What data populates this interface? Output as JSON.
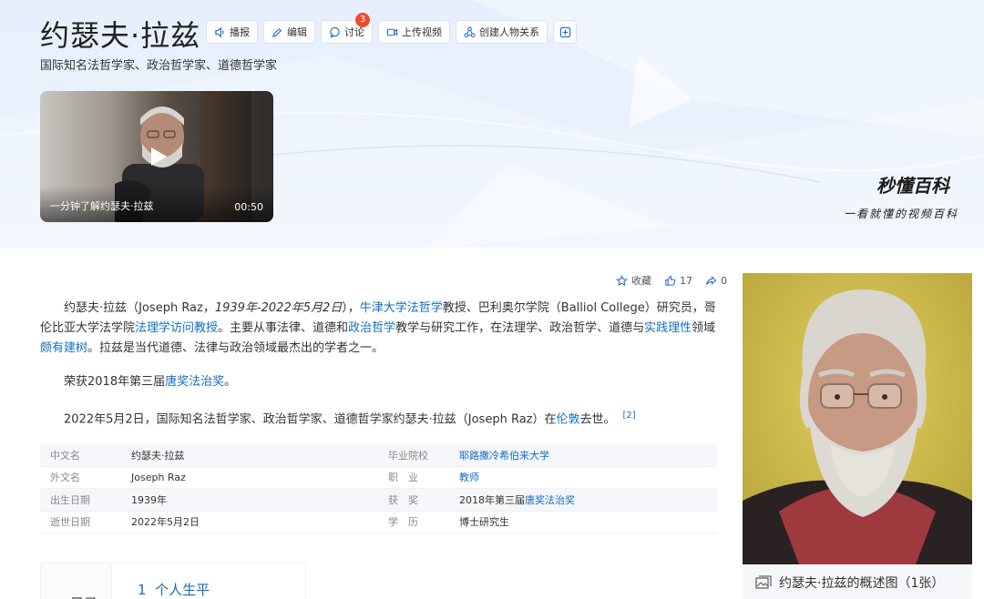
{
  "header": {
    "title": "约瑟夫·拉兹",
    "subtitle": "国际知名法哲学家、政治哲学家、道德哲学家",
    "toolbar": {
      "play_label": "播报",
      "edit_label": "编辑",
      "discuss_label": "讨论",
      "discuss_badge": "3",
      "upload_label": "上传视频",
      "relation_label": "创建人物关系"
    },
    "video": {
      "caption": "一分钟了解约瑟夫·拉兹",
      "duration": "00:50"
    },
    "brand": {
      "name": "秒懂百科",
      "slogan": "一看就懂的视频百科"
    }
  },
  "actions": {
    "favorite_label": "收藏",
    "like_count": "17",
    "share_count": "0"
  },
  "summary": {
    "p1": {
      "t1": "约瑟夫·拉兹（Joseph Raz，",
      "dates": "1939年-2022年5月2日",
      "t2": "），",
      "l1": "牛津大学法哲学",
      "t3": "教授、巴利奥尔学院（Balliol College）研究员，哥伦比亚大学法学院",
      "l2": "法理学访问教授",
      "t4": "。主要从事法律、道德和",
      "l3": "政治哲学",
      "t5": "教学与研究工作，在法理学、政治哲学、道德与",
      "l4": "实践理性",
      "t6": "领域",
      "l5": "颇有建树",
      "t7": "。拉兹是当代道德、法律与政治领域最杰出的学者之一。"
    },
    "p2": {
      "t1": "荣获2018年第三届",
      "l1": "唐奖法治奖",
      "t2": "。"
    },
    "p3": {
      "t1": "2022年5月2日，国际知名法哲学家、政治哲学家、道德哲学家约瑟夫·拉兹（Joseph Raz）在",
      "l1": "伦敦",
      "t2": "去世。",
      "ref": "[2]"
    }
  },
  "infobox": {
    "rows": [
      {
        "k1": "中文名",
        "v1": "约瑟夫·拉兹",
        "k2": "毕业院校",
        "v2_link": "耶路撒冷希伯来大学"
      },
      {
        "k1": "外文名",
        "v1": "Joseph Raz",
        "k2": "职　业",
        "v2_link": "教师"
      },
      {
        "k1": "出生日期",
        "v1": "1939年",
        "k2": "获　奖",
        "v2_text": "2018年第三届",
        "v2_link": "唐奖法治奖"
      },
      {
        "k1": "逝世日期",
        "v1": "2022年5月2日",
        "k2": "学　历",
        "v2_text": "博士研究生"
      }
    ]
  },
  "toc": {
    "label": "目录",
    "first_item_num": "1",
    "first_item_label": "个人生平"
  },
  "portrait": {
    "caption": "约瑟夫·拉兹的概述图（1张）"
  }
}
